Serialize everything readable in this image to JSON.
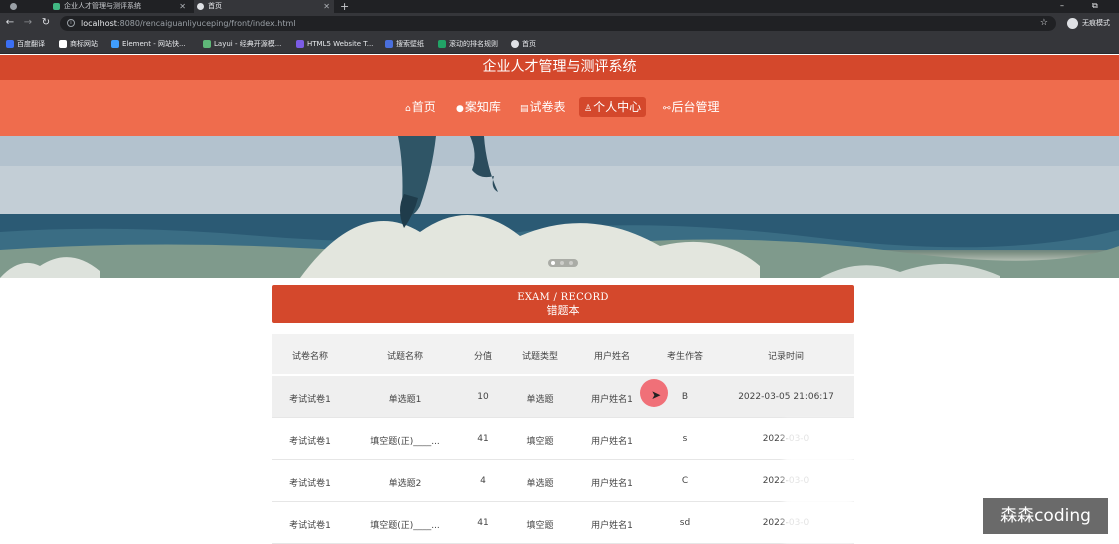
{
  "browser": {
    "tabs": [
      {
        "label": "企业人才管理与测评系统",
        "active": false
      },
      {
        "label": "首页",
        "active": true
      }
    ],
    "new_tab_glyph": "+",
    "window_controls": [
      "–",
      "⧉"
    ],
    "url_host": "localhost",
    "url_rest": ":8080/rencaiguanliyuceping/front/index.html",
    "profile_label": "无痕模式",
    "bookmarks": [
      {
        "label": "百度翻译",
        "icon": "translate-icon",
        "color": "#3b6ff3"
      },
      {
        "label": "商标网站",
        "icon": "flag-icon",
        "color": "#ffffff"
      },
      {
        "label": "Element - 网站快...",
        "icon": "element-icon",
        "color": "#409eff"
      },
      {
        "label": "Layui - 经典开源模...",
        "icon": "layui-icon",
        "color": "#5fb878"
      },
      {
        "label": "HTML5 Website T...",
        "icon": "html5-icon",
        "color": "#7b5ce5"
      },
      {
        "label": "搜索壁纸",
        "icon": "wallpaper-icon",
        "color": "#4a6fdc"
      },
      {
        "label": "滚动的排名规则",
        "icon": "rank-icon",
        "color": "#21a366"
      },
      {
        "label": "首页",
        "icon": "globe-icon",
        "color": "#dfe1e5"
      }
    ]
  },
  "site": {
    "title": "企业人才管理与测评系统",
    "nav": [
      {
        "label": "首页",
        "icon": "home-icon",
        "glyph": "⌂",
        "active": false
      },
      {
        "label": "案知库",
        "icon": "circle-icon",
        "glyph": "●",
        "active": false
      },
      {
        "label": "试卷表",
        "icon": "paper-icon",
        "glyph": "▤",
        "active": false
      },
      {
        "label": "个人中心",
        "icon": "user-icon",
        "glyph": "♙",
        "active": true
      },
      {
        "label": "后台管理",
        "icon": "link-icon",
        "glyph": "⚯",
        "active": false
      }
    ],
    "accent": "#d4482c",
    "nav_bg": "#ef6c4d"
  },
  "section": {
    "title_en": "EXAM / RECORD",
    "title_zh": "错题本"
  },
  "table": {
    "columns": [
      "试卷名称",
      "试题名称",
      "分值",
      "试题类型",
      "用户姓名",
      "考生作答",
      "记录时间"
    ],
    "rows": [
      [
        "考试试卷1",
        "单选题1",
        "10",
        "单选题",
        "用户姓名1",
        "B",
        "2022-03-05 21:06:17"
      ],
      [
        "考试试卷1",
        "填空题(正)____...",
        "41",
        "填空题",
        "用户姓名1",
        "s",
        "2022-03-0"
      ],
      [
        "考试试卷1",
        "单选题2",
        "4",
        "单选题",
        "用户姓名1",
        "C",
        "2022-03-0"
      ],
      [
        "考试试卷1",
        "填空题(正)____...",
        "41",
        "填空题",
        "用户姓名1",
        "sd",
        "2022-03-0"
      ]
    ]
  },
  "watermark": "森森coding"
}
